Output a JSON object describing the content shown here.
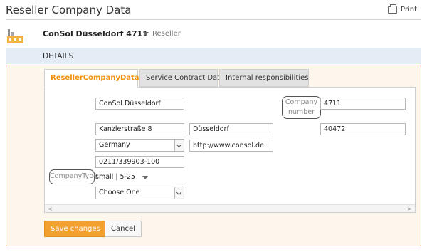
{
  "page": {
    "title": "Reseller Company Data",
    "print_label": "Print"
  },
  "company": {
    "name": "ConSol Düsseldorf 4711",
    "role": "Reseller",
    "icon": "factory-icon"
  },
  "details": {
    "label": "DETAILS"
  },
  "tabs": [
    {
      "label": "ResellerCompanyData",
      "active": true
    },
    {
      "label": "Service Contract Data",
      "active": false
    },
    {
      "label": "Internal responsibilities",
      "active": false
    }
  ],
  "form": {
    "company_name": "ConSol Düsseldorf",
    "company_number_label_1": "Company",
    "company_number_label_2": "number",
    "company_number": "4711",
    "street": "Kanzlerstraße 8",
    "city": "Düsseldorf",
    "zip": "40472",
    "country": "Germany",
    "website": "http://www.consol.de",
    "phone": "0211/339903-100",
    "company_type_label": "CompanyType",
    "company_type_value": "small | 5-25",
    "choose": "Choose One"
  },
  "buttons": {
    "save": "Save changes",
    "cancel": "Cancel"
  },
  "colors": {
    "accent": "#f2a030",
    "tab_active_text": "#f0900f",
    "header_band": "#e4ecf5",
    "panel_bg": "#fcf6ec"
  }
}
